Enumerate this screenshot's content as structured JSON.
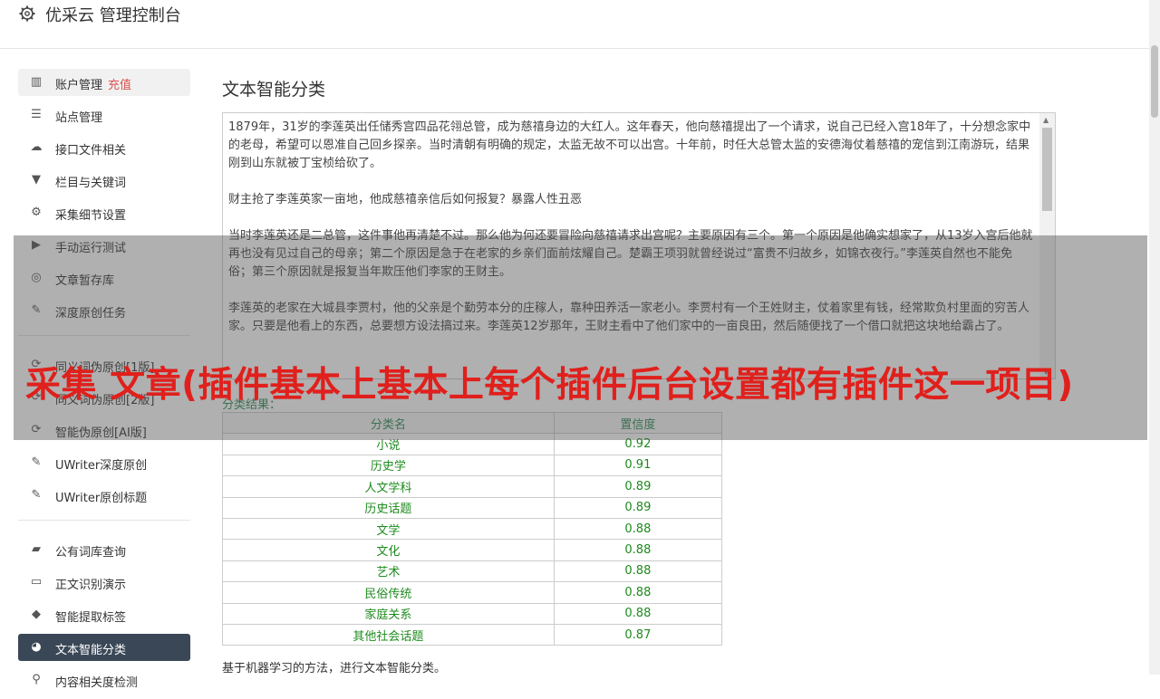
{
  "header": {
    "title": "优采云 管理控制台"
  },
  "sidebar": {
    "group1": [
      {
        "label": "账户管理",
        "badge": "充值",
        "icon": "bar-chart-icon"
      },
      {
        "label": "站点管理",
        "icon": "server-icon"
      },
      {
        "label": "接口文件相关",
        "icon": "cloud-upload-icon"
      },
      {
        "label": "栏目与关键词",
        "icon": "filter-icon"
      },
      {
        "label": "采集细节设置",
        "icon": "gears-icon"
      },
      {
        "label": "手动运行测试",
        "icon": "play-icon"
      },
      {
        "label": "文章暂存库",
        "icon": "database-icon"
      },
      {
        "label": "深度原创任务",
        "icon": "edit-icon"
      }
    ],
    "group2": [
      {
        "label": "同义词伪原创[1版]",
        "icon": "refresh-icon"
      },
      {
        "label": "同义词伪原创[2版]",
        "icon": "refresh-icon"
      },
      {
        "label": "智能伪原创[AI版]",
        "icon": "refresh-icon"
      },
      {
        "label": "UWriter深度原创",
        "icon": "edit-icon"
      },
      {
        "label": "UWriter原创标题",
        "icon": "edit-icon"
      }
    ],
    "group3": [
      {
        "label": "公有词库查询",
        "icon": "book-icon"
      },
      {
        "label": "正文识别演示",
        "icon": "monitor-icon"
      },
      {
        "label": "智能提取标签",
        "icon": "tag-icon"
      },
      {
        "label": "文本智能分类",
        "icon": "pie-chart-icon"
      },
      {
        "label": "内容相关度检测",
        "icon": "search-icon"
      }
    ]
  },
  "main": {
    "title": "文本智能分类",
    "textarea_paragraphs": [
      "1879年，31岁的李莲英出任储秀宫四品花翎总管，成为慈禧身边的大红人。这年春天，他向慈禧提出了一个请求，说自己已经入宫18年了，十分想念家中的老母，希望可以恩准自己回乡探亲。当时清朝有明确的规定，太监无故不可以出宫。十年前，时任大总管太监的安德海仗着慈禧的宠信到江南游玩，结果刚到山东就被丁宝桢给砍了。",
      "财主抢了李莲英家一亩地，他成慈禧亲信后如何报复？暴露人性丑恶",
      "当时李莲英还是二总管，这件事他再清楚不过。那么他为何还要冒险向慈禧请求出宫呢？主要原因有三个。第一个原因是他确实想家了，从13岁入宫后他就再也没有见过自己的母亲；第二个原因是急于在老家的乡亲们面前炫耀自己。楚霸王项羽就曾经说过“富贵不归故乡，如锦衣夜行。”李莲英自然也不能免俗；第三个原因就是报复当年欺压他们李家的王财主。",
      "李莲英的老家在大城县李贾村，他的父亲是个勤劳本分的庄稼人，靠种田养活一家老小。李贾村有一个王姓财主，仗着家里有钱，经常欺负村里面的穷苦人家。只要是他看上的东西，总要想方设法搞过来。李莲英12岁那年，王财主看中了他们家中的一亩良田，然后随便找了一个借口就把这块地给霸占了。"
    ],
    "result_label": "分类结果：",
    "table_headers": [
      "分类名",
      "置信度"
    ],
    "rows": [
      [
        "小说",
        "0.92"
      ],
      [
        "历史学",
        "0.91"
      ],
      [
        "人文学科",
        "0.89"
      ],
      [
        "历史话题",
        "0.89"
      ],
      [
        "文学",
        "0.88"
      ],
      [
        "文化",
        "0.88"
      ],
      [
        "艺术",
        "0.88"
      ],
      [
        "民俗传统",
        "0.88"
      ],
      [
        "家庭关系",
        "0.88"
      ],
      [
        "其他社会话题",
        "0.87"
      ]
    ],
    "footnote": "基于机器学习的方法，进行文本智能分类。"
  },
  "overlay": {
    "text": "采集 文章(插件基本上基本上每个插件后台设置都有插件这一项目)"
  },
  "colors": {
    "active_bg": "#3a4757",
    "badge": "#d9534f",
    "table_text": "#1e8a1e",
    "overlay_text": "#e0201c"
  }
}
